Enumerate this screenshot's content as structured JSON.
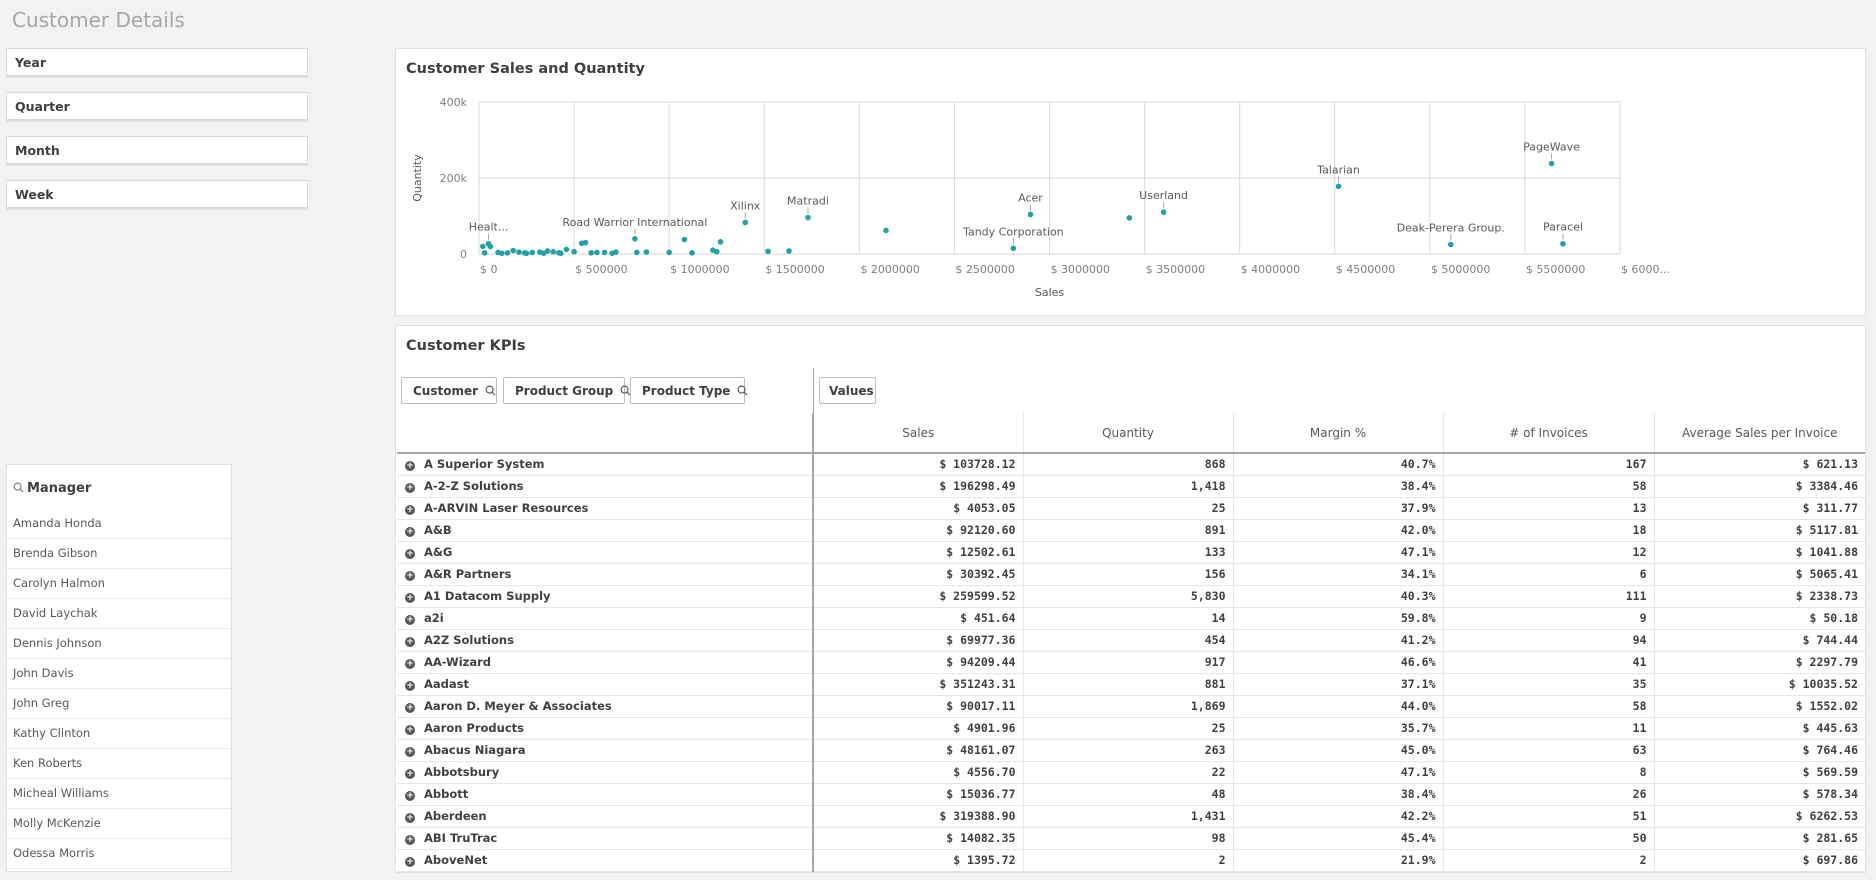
{
  "page": {
    "title": "Customer Details"
  },
  "filters": [
    "Year",
    "Quarter",
    "Month",
    "Week"
  ],
  "manager": {
    "title": "Manager",
    "items": [
      "Amanda Honda",
      "Brenda Gibson",
      "Carolyn Halmon",
      "David Laychak",
      "Dennis Johnson",
      "John Davis",
      "John Greg",
      "Kathy Clinton",
      "Ken Roberts",
      "Micheal Williams",
      "Molly McKenzie",
      "Odessa Morris"
    ]
  },
  "chart": {
    "title": "Customer Sales and Quantity"
  },
  "chart_data": {
    "type": "scatter",
    "title": "Customer Sales and Quantity",
    "xlabel": "Sales",
    "ylabel": "Quantity",
    "xlim": [
      0,
      6000000
    ],
    "ylim": [
      0,
      400000
    ],
    "grid": true,
    "point_color": "#25a0a6",
    "x_ticks": [
      "$ 0",
      "$ 500000",
      "$ 1000000",
      "$ 1500000",
      "$ 2000000",
      "$ 2500000",
      "$ 3000000",
      "$ 3500000",
      "$ 4000000",
      "$ 4500000",
      "$ 5000000",
      "$ 5500000",
      "$ 6000..."
    ],
    "y_ticks": [
      "0",
      "200k",
      "400k"
    ],
    "points": [
      {
        "x": 5640000,
        "y": 238000,
        "label": "PageWave"
      },
      {
        "x": 4520000,
        "y": 178000,
        "label": "Talarian"
      },
      {
        "x": 3600000,
        "y": 110000,
        "label": "Userland"
      },
      {
        "x": 2900000,
        "y": 104000,
        "label": "Acer"
      },
      {
        "x": 1730000,
        "y": 96000,
        "label": "Matradi"
      },
      {
        "x": 1400000,
        "y": 83000,
        "label": "Xilinx"
      },
      {
        "x": 820000,
        "y": 40000,
        "label": "Road Warrior International"
      },
      {
        "x": 2810000,
        "y": 15000,
        "label": "Tandy Corporation"
      },
      {
        "x": 5110000,
        "y": 25000,
        "label": "Deak-Perera Group."
      },
      {
        "x": 5700000,
        "y": 27000,
        "label": "Paracel"
      },
      {
        "x": 50000,
        "y": 27000,
        "label": "Healt..."
      },
      {
        "x": 3420000,
        "y": 95000,
        "label": ""
      },
      {
        "x": 2140000,
        "y": 62000,
        "label": ""
      },
      {
        "x": 1080000,
        "y": 38000,
        "label": ""
      },
      {
        "x": 1270000,
        "y": 32000,
        "label": ""
      },
      {
        "x": 540000,
        "y": 28000,
        "label": ""
      },
      {
        "x": 560000,
        "y": 30000,
        "label": ""
      },
      {
        "x": 60000,
        "y": 20000,
        "label": ""
      },
      {
        "x": 20000,
        "y": 20000,
        "label": ""
      },
      {
        "x": 1230000,
        "y": 10000,
        "label": ""
      },
      {
        "x": 1250000,
        "y": 6000,
        "label": ""
      },
      {
        "x": 1630000,
        "y": 8000,
        "label": ""
      },
      {
        "x": 1520000,
        "y": 7000,
        "label": ""
      },
      {
        "x": 1000000,
        "y": 4000,
        "label": ""
      },
      {
        "x": 1120000,
        "y": 3000,
        "label": ""
      },
      {
        "x": 880000,
        "y": 5000,
        "label": ""
      },
      {
        "x": 830000,
        "y": 4000,
        "label": ""
      },
      {
        "x": 720000,
        "y": 5000,
        "label": ""
      },
      {
        "x": 660000,
        "y": 4000,
        "label": ""
      },
      {
        "x": 460000,
        "y": 12000,
        "label": ""
      },
      {
        "x": 360000,
        "y": 8000,
        "label": ""
      },
      {
        "x": 180000,
        "y": 9000,
        "label": ""
      },
      {
        "x": 30000,
        "y": 3000,
        "label": ""
      },
      {
        "x": 100000,
        "y": 4000,
        "label": ""
      },
      {
        "x": 150000,
        "y": 3000,
        "label": ""
      },
      {
        "x": 210000,
        "y": 5000,
        "label": ""
      },
      {
        "x": 240000,
        "y": 3000,
        "label": ""
      },
      {
        "x": 280000,
        "y": 4000,
        "label": ""
      },
      {
        "x": 320000,
        "y": 5000,
        "label": ""
      },
      {
        "x": 390000,
        "y": 6000,
        "label": ""
      },
      {
        "x": 420000,
        "y": 3000,
        "label": ""
      },
      {
        "x": 500000,
        "y": 6000,
        "label": ""
      },
      {
        "x": 590000,
        "y": 3000,
        "label": ""
      },
      {
        "x": 620000,
        "y": 4000,
        "label": ""
      },
      {
        "x": 120000,
        "y": 2000,
        "label": ""
      },
      {
        "x": 250000,
        "y": 2000,
        "label": ""
      },
      {
        "x": 340000,
        "y": 2000,
        "label": ""
      },
      {
        "x": 430000,
        "y": 2000,
        "label": ""
      },
      {
        "x": 700000,
        "y": 2000,
        "label": ""
      }
    ]
  },
  "kpi": {
    "title": "Customer KPIs",
    "dimensions": [
      "Customer",
      "Product Group",
      "Product Type"
    ],
    "values_label": "Values",
    "columns": [
      "Sales",
      "Quantity",
      "Margin %",
      "# of Invoices",
      "Average Sales per Invoice"
    ],
    "rows": [
      {
        "customer": "A Superior System",
        "cells": [
          "$ 103728.12",
          "868",
          "40.7%",
          "167",
          "$ 621.13"
        ]
      },
      {
        "customer": "A-2-Z Solutions",
        "cells": [
          "$ 196298.49",
          "1,418",
          "38.4%",
          "58",
          "$ 3384.46"
        ]
      },
      {
        "customer": "A-ARVIN Laser Resources",
        "cells": [
          "$ 4053.05",
          "25",
          "37.9%",
          "13",
          "$ 311.77"
        ]
      },
      {
        "customer": "A&B",
        "cells": [
          "$ 92120.60",
          "891",
          "42.0%",
          "18",
          "$ 5117.81"
        ]
      },
      {
        "customer": "A&G",
        "cells": [
          "$ 12502.61",
          "133",
          "47.1%",
          "12",
          "$ 1041.88"
        ]
      },
      {
        "customer": "A&R Partners",
        "cells": [
          "$ 30392.45",
          "156",
          "34.1%",
          "6",
          "$ 5065.41"
        ]
      },
      {
        "customer": "A1 Datacom Supply",
        "cells": [
          "$ 259599.52",
          "5,830",
          "40.3%",
          "111",
          "$ 2338.73"
        ]
      },
      {
        "customer": "a2i",
        "cells": [
          "$ 451.64",
          "14",
          "59.8%",
          "9",
          "$ 50.18"
        ]
      },
      {
        "customer": "A2Z Solutions",
        "cells": [
          "$ 69977.36",
          "454",
          "41.2%",
          "94",
          "$ 744.44"
        ]
      },
      {
        "customer": "AA-Wizard",
        "cells": [
          "$ 94209.44",
          "917",
          "46.6%",
          "41",
          "$ 2297.79"
        ]
      },
      {
        "customer": "Aadast",
        "cells": [
          "$ 351243.31",
          "881",
          "37.1%",
          "35",
          "$ 10035.52"
        ]
      },
      {
        "customer": "Aaron D. Meyer & Associates",
        "cells": [
          "$ 90017.11",
          "1,869",
          "44.0%",
          "58",
          "$ 1552.02"
        ]
      },
      {
        "customer": "Aaron Products",
        "cells": [
          "$ 4901.96",
          "25",
          "35.7%",
          "11",
          "$ 445.63"
        ]
      },
      {
        "customer": "Abacus Niagara",
        "cells": [
          "$ 48161.07",
          "263",
          "45.0%",
          "63",
          "$ 764.46"
        ]
      },
      {
        "customer": "Abbotsbury",
        "cells": [
          "$ 4556.70",
          "22",
          "47.1%",
          "8",
          "$ 569.59"
        ]
      },
      {
        "customer": "Abbott",
        "cells": [
          "$ 15036.77",
          "48",
          "38.4%",
          "26",
          "$ 578.34"
        ]
      },
      {
        "customer": "Aberdeen",
        "cells": [
          "$ 319388.90",
          "1,431",
          "42.2%",
          "51",
          "$ 6262.53"
        ]
      },
      {
        "customer": "ABI TruTrac",
        "cells": [
          "$ 14082.35",
          "98",
          "45.4%",
          "50",
          "$ 281.65"
        ]
      },
      {
        "customer": "AboveNet",
        "cells": [
          "$ 1395.72",
          "2",
          "21.9%",
          "2",
          "$ 697.86"
        ]
      }
    ]
  }
}
